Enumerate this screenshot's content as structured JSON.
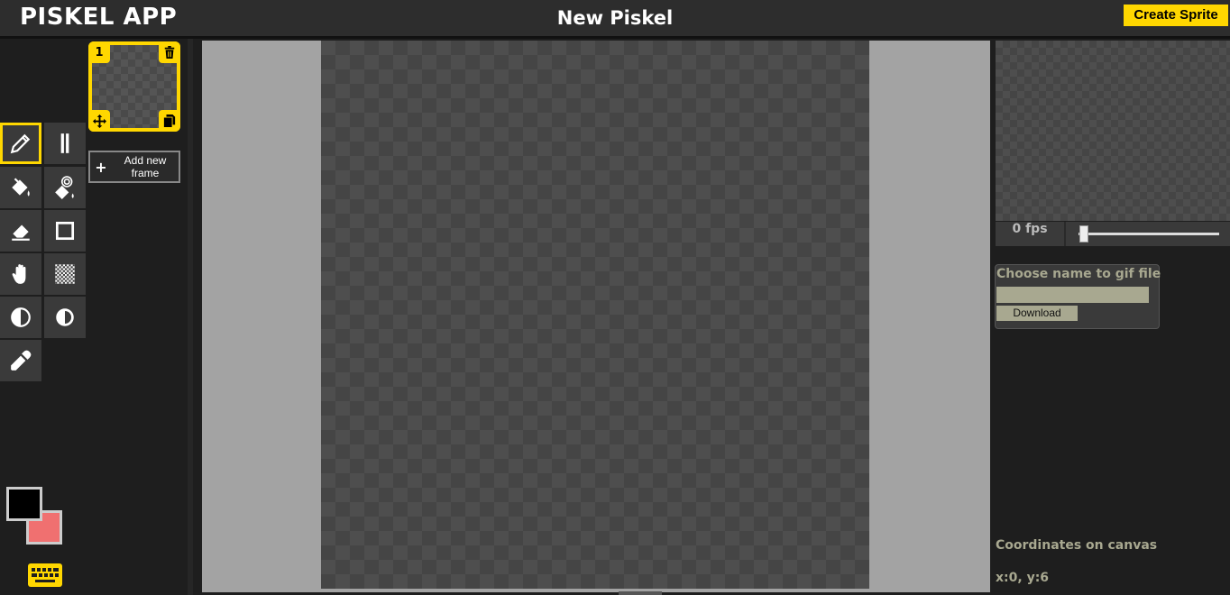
{
  "header": {
    "app_title": "PISKEL APP",
    "document_title": "New Piskel",
    "create_button": "Create Sprite",
    "accent_color": "#ffd700"
  },
  "tools": [
    {
      "name": "pen-tool",
      "icon": "pencil-icon",
      "active": true
    },
    {
      "name": "vertical-mirror-pen-tool",
      "icon": "mirror-lines-icon",
      "active": false
    },
    {
      "name": "paint-bucket-tool",
      "icon": "paint-bucket-icon",
      "active": false
    },
    {
      "name": "paint-same-color-tool",
      "icon": "spiral-bucket-icon",
      "active": false
    },
    {
      "name": "eraser-tool",
      "icon": "eraser-icon",
      "active": false
    },
    {
      "name": "rectangle-tool",
      "icon": "square-outline-icon",
      "active": false
    },
    {
      "name": "move-tool",
      "icon": "hand-icon",
      "active": false
    },
    {
      "name": "dithering-tool",
      "icon": "checker-icon",
      "active": false
    },
    {
      "name": "lighten-tool",
      "icon": "half-circle-icon",
      "active": false
    },
    {
      "name": "darken-tool",
      "icon": "half-circle-inverted-icon",
      "active": false
    },
    {
      "name": "color-picker-tool",
      "icon": "eyedropper-icon",
      "active": false
    }
  ],
  "frames": {
    "items": [
      {
        "number": "1"
      }
    ],
    "add_label": "Add new frame",
    "add_symbol": "+"
  },
  "preview": {
    "fps_label": "0 fps",
    "fps_value": 0
  },
  "gif_export": {
    "title": "Choose name to gif file",
    "input_value": "",
    "download_label": "Download"
  },
  "coordinates": {
    "label": "Coordinates on canvas",
    "value": "x:0, y:6"
  },
  "colors": {
    "primary": "#000000",
    "secondary": "#f07070"
  }
}
